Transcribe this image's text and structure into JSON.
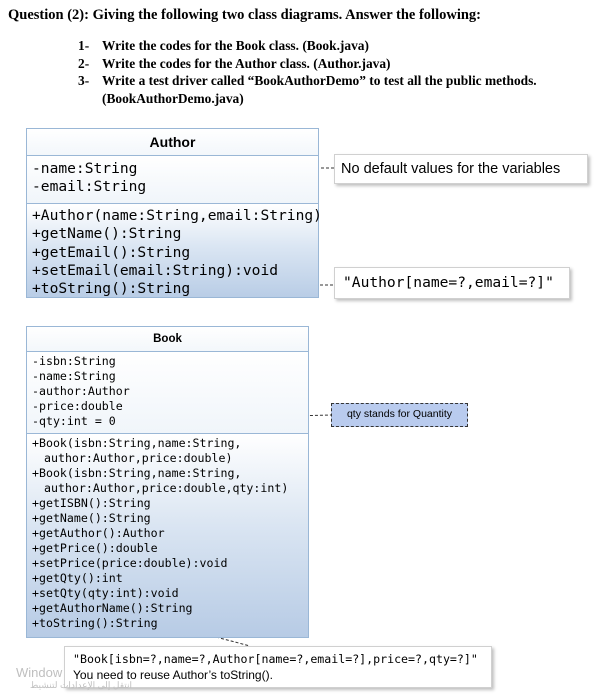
{
  "question": {
    "heading": "Question (2): Giving the following two class diagrams. Answer the following:",
    "items": [
      {
        "number": "1-",
        "text": "Write the codes for the Book class. (Book.java)"
      },
      {
        "number": "2-",
        "text": "Write the codes for the Author class. (Author.java)"
      },
      {
        "number": "3-",
        "text": "Write a test driver called “BookAuthorDemo” to test all the public methods. (BookAuthorDemo.java)"
      }
    ]
  },
  "author_class": {
    "name": "Author",
    "attributes": [
      "-name:String",
      "-email:String"
    ],
    "methods": [
      "+Author(name:String,email:String)",
      "+getName():String",
      "+getEmail():String",
      "+setEmail(email:String):void",
      "+toString():String"
    ]
  },
  "book_class": {
    "name": "Book",
    "attributes": [
      "-isbn:String",
      "-name:String",
      "-author:Author",
      "-price:double",
      "-qty:int = 0"
    ],
    "methods": [
      "+Book(isbn:String,name:String,",
      "author:Author,price:double)",
      "+Book(isbn:String,name:String,",
      "author:Author,price:double,qty:int)",
      "+getISBN():String",
      "+getName():String",
      "+getAuthor():Author",
      "+getPrice():double",
      "+setPrice(price:double):void",
      "+getQty():int",
      "+setQty(qty:int):void",
      "+getAuthorName():String",
      "+toString():String"
    ]
  },
  "notes": {
    "no_defaults": "No default values for the variables",
    "author_tostring": "\"Author[name=?,email=?]\"",
    "qty_note": "qty stands for Quantity",
    "book_tostring": "\"Book[isbn=?,name=?,Author[name=?,email=?],price=?,qty=?]\"",
    "reuse_note": "You need to reuse Author’s toString()."
  },
  "watermark": {
    "line1": "Window",
    "line2": "انتقل إلى الإعدادات لتنشيط"
  }
}
